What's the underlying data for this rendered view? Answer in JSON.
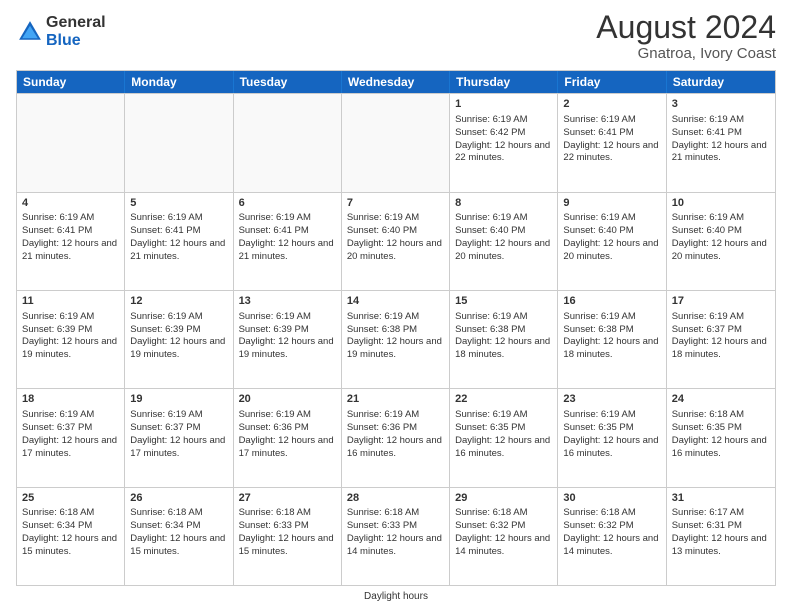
{
  "logo": {
    "general": "General",
    "blue": "Blue"
  },
  "title": "August 2024",
  "subtitle": "Gnatroa, Ivory Coast",
  "footer": "Daylight hours",
  "days_of_week": [
    "Sunday",
    "Monday",
    "Tuesday",
    "Wednesday",
    "Thursday",
    "Friday",
    "Saturday"
  ],
  "weeks": [
    [
      {
        "day": "",
        "info": "",
        "empty": true
      },
      {
        "day": "",
        "info": "",
        "empty": true
      },
      {
        "day": "",
        "info": "",
        "empty": true
      },
      {
        "day": "",
        "info": "",
        "empty": true
      },
      {
        "day": "1",
        "info": "Sunrise: 6:19 AM\nSunset: 6:42 PM\nDaylight: 12 hours and 22 minutes."
      },
      {
        "day": "2",
        "info": "Sunrise: 6:19 AM\nSunset: 6:41 PM\nDaylight: 12 hours and 22 minutes."
      },
      {
        "day": "3",
        "info": "Sunrise: 6:19 AM\nSunset: 6:41 PM\nDaylight: 12 hours and 21 minutes."
      }
    ],
    [
      {
        "day": "4",
        "info": "Sunrise: 6:19 AM\nSunset: 6:41 PM\nDaylight: 12 hours and 21 minutes."
      },
      {
        "day": "5",
        "info": "Sunrise: 6:19 AM\nSunset: 6:41 PM\nDaylight: 12 hours and 21 minutes."
      },
      {
        "day": "6",
        "info": "Sunrise: 6:19 AM\nSunset: 6:41 PM\nDaylight: 12 hours and 21 minutes."
      },
      {
        "day": "7",
        "info": "Sunrise: 6:19 AM\nSunset: 6:40 PM\nDaylight: 12 hours and 20 minutes."
      },
      {
        "day": "8",
        "info": "Sunrise: 6:19 AM\nSunset: 6:40 PM\nDaylight: 12 hours and 20 minutes."
      },
      {
        "day": "9",
        "info": "Sunrise: 6:19 AM\nSunset: 6:40 PM\nDaylight: 12 hours and 20 minutes."
      },
      {
        "day": "10",
        "info": "Sunrise: 6:19 AM\nSunset: 6:40 PM\nDaylight: 12 hours and 20 minutes."
      }
    ],
    [
      {
        "day": "11",
        "info": "Sunrise: 6:19 AM\nSunset: 6:39 PM\nDaylight: 12 hours and 19 minutes."
      },
      {
        "day": "12",
        "info": "Sunrise: 6:19 AM\nSunset: 6:39 PM\nDaylight: 12 hours and 19 minutes."
      },
      {
        "day": "13",
        "info": "Sunrise: 6:19 AM\nSunset: 6:39 PM\nDaylight: 12 hours and 19 minutes."
      },
      {
        "day": "14",
        "info": "Sunrise: 6:19 AM\nSunset: 6:38 PM\nDaylight: 12 hours and 19 minutes."
      },
      {
        "day": "15",
        "info": "Sunrise: 6:19 AM\nSunset: 6:38 PM\nDaylight: 12 hours and 18 minutes."
      },
      {
        "day": "16",
        "info": "Sunrise: 6:19 AM\nSunset: 6:38 PM\nDaylight: 12 hours and 18 minutes."
      },
      {
        "day": "17",
        "info": "Sunrise: 6:19 AM\nSunset: 6:37 PM\nDaylight: 12 hours and 18 minutes."
      }
    ],
    [
      {
        "day": "18",
        "info": "Sunrise: 6:19 AM\nSunset: 6:37 PM\nDaylight: 12 hours and 17 minutes."
      },
      {
        "day": "19",
        "info": "Sunrise: 6:19 AM\nSunset: 6:37 PM\nDaylight: 12 hours and 17 minutes."
      },
      {
        "day": "20",
        "info": "Sunrise: 6:19 AM\nSunset: 6:36 PM\nDaylight: 12 hours and 17 minutes."
      },
      {
        "day": "21",
        "info": "Sunrise: 6:19 AM\nSunset: 6:36 PM\nDaylight: 12 hours and 16 minutes."
      },
      {
        "day": "22",
        "info": "Sunrise: 6:19 AM\nSunset: 6:35 PM\nDaylight: 12 hours and 16 minutes."
      },
      {
        "day": "23",
        "info": "Sunrise: 6:19 AM\nSunset: 6:35 PM\nDaylight: 12 hours and 16 minutes."
      },
      {
        "day": "24",
        "info": "Sunrise: 6:18 AM\nSunset: 6:35 PM\nDaylight: 12 hours and 16 minutes."
      }
    ],
    [
      {
        "day": "25",
        "info": "Sunrise: 6:18 AM\nSunset: 6:34 PM\nDaylight: 12 hours and 15 minutes."
      },
      {
        "day": "26",
        "info": "Sunrise: 6:18 AM\nSunset: 6:34 PM\nDaylight: 12 hours and 15 minutes."
      },
      {
        "day": "27",
        "info": "Sunrise: 6:18 AM\nSunset: 6:33 PM\nDaylight: 12 hours and 15 minutes."
      },
      {
        "day": "28",
        "info": "Sunrise: 6:18 AM\nSunset: 6:33 PM\nDaylight: 12 hours and 14 minutes."
      },
      {
        "day": "29",
        "info": "Sunrise: 6:18 AM\nSunset: 6:32 PM\nDaylight: 12 hours and 14 minutes."
      },
      {
        "day": "30",
        "info": "Sunrise: 6:18 AM\nSunset: 6:32 PM\nDaylight: 12 hours and 14 minutes."
      },
      {
        "day": "31",
        "info": "Sunrise: 6:17 AM\nSunset: 6:31 PM\nDaylight: 12 hours and 13 minutes."
      }
    ]
  ]
}
